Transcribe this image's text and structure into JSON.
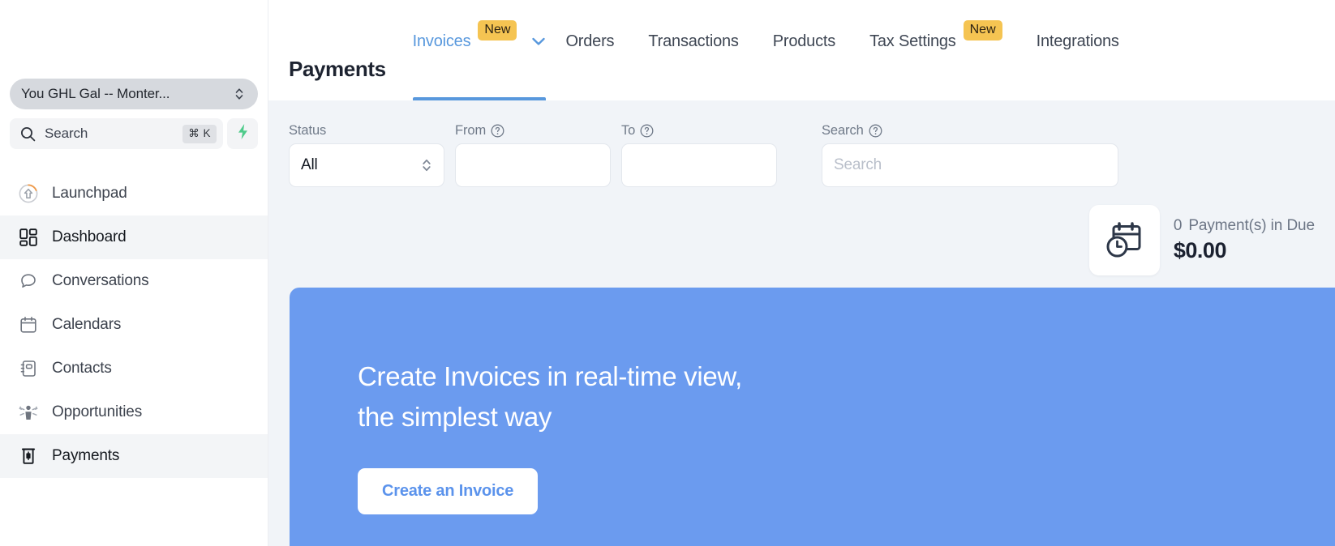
{
  "sidebar": {
    "account": {
      "name": "You GHL Gal -- Monter...",
      "switch_icon": "chevron-up-down-icon"
    },
    "search": {
      "placeholder": "Search",
      "shortcut": "⌘ K",
      "icon": "search-icon",
      "quick_action_icon": "lightning-bolt-icon"
    },
    "items": [
      {
        "label": "Launchpad",
        "icon": "launchpad-rocket-icon",
        "active": false
      },
      {
        "label": "Dashboard",
        "icon": "dashboard-grid-icon",
        "active": true
      },
      {
        "label": "Conversations",
        "icon": "chat-bubble-icon",
        "active": false
      },
      {
        "label": "Calendars",
        "icon": "calendar-icon",
        "active": false
      },
      {
        "label": "Contacts",
        "icon": "contact-book-icon",
        "active": false
      },
      {
        "label": "Opportunities",
        "icon": "opportunities-person-icon",
        "active": false
      },
      {
        "label": "Payments",
        "icon": "payments-dollar-bill-icon",
        "active": true
      }
    ]
  },
  "header": {
    "title": "Payments",
    "tabs": [
      {
        "label": "Invoices",
        "badge": "New",
        "active": true,
        "has_dropdown": true
      },
      {
        "label": "Orders",
        "badge": null,
        "active": false,
        "has_dropdown": false
      },
      {
        "label": "Transactions",
        "badge": null,
        "active": false,
        "has_dropdown": false
      },
      {
        "label": "Products",
        "badge": null,
        "active": false,
        "has_dropdown": false
      },
      {
        "label": "Tax Settings",
        "badge": "New",
        "active": false,
        "has_dropdown": false
      },
      {
        "label": "Integrations",
        "badge": null,
        "active": false,
        "has_dropdown": false
      }
    ]
  },
  "filters": {
    "status": {
      "label": "Status",
      "value": "All",
      "has_help": false
    },
    "from": {
      "label": "From",
      "value": "",
      "placeholder": "",
      "has_help": true
    },
    "to": {
      "label": "To",
      "value": "",
      "placeholder": "",
      "has_help": true
    },
    "search": {
      "label": "Search",
      "value": "",
      "placeholder": "Search",
      "has_help": true
    }
  },
  "due_summary": {
    "icon": "calendar-clock-icon",
    "count": "0",
    "label": "Payment(s) in Due",
    "amount": "$0.00"
  },
  "banner": {
    "headline_line1": "Create Invoices in real-time view,",
    "headline_line2": "the simplest way",
    "cta_label": "Create an Invoice",
    "background_color": "#6b9bef"
  },
  "colors": {
    "accent_blue": "#5898dd",
    "badge_amber": "#f5c452",
    "banner_blue": "#6b9bef",
    "bolt_green": "#4ecb8a",
    "page_bg": "#f1f4f8"
  }
}
